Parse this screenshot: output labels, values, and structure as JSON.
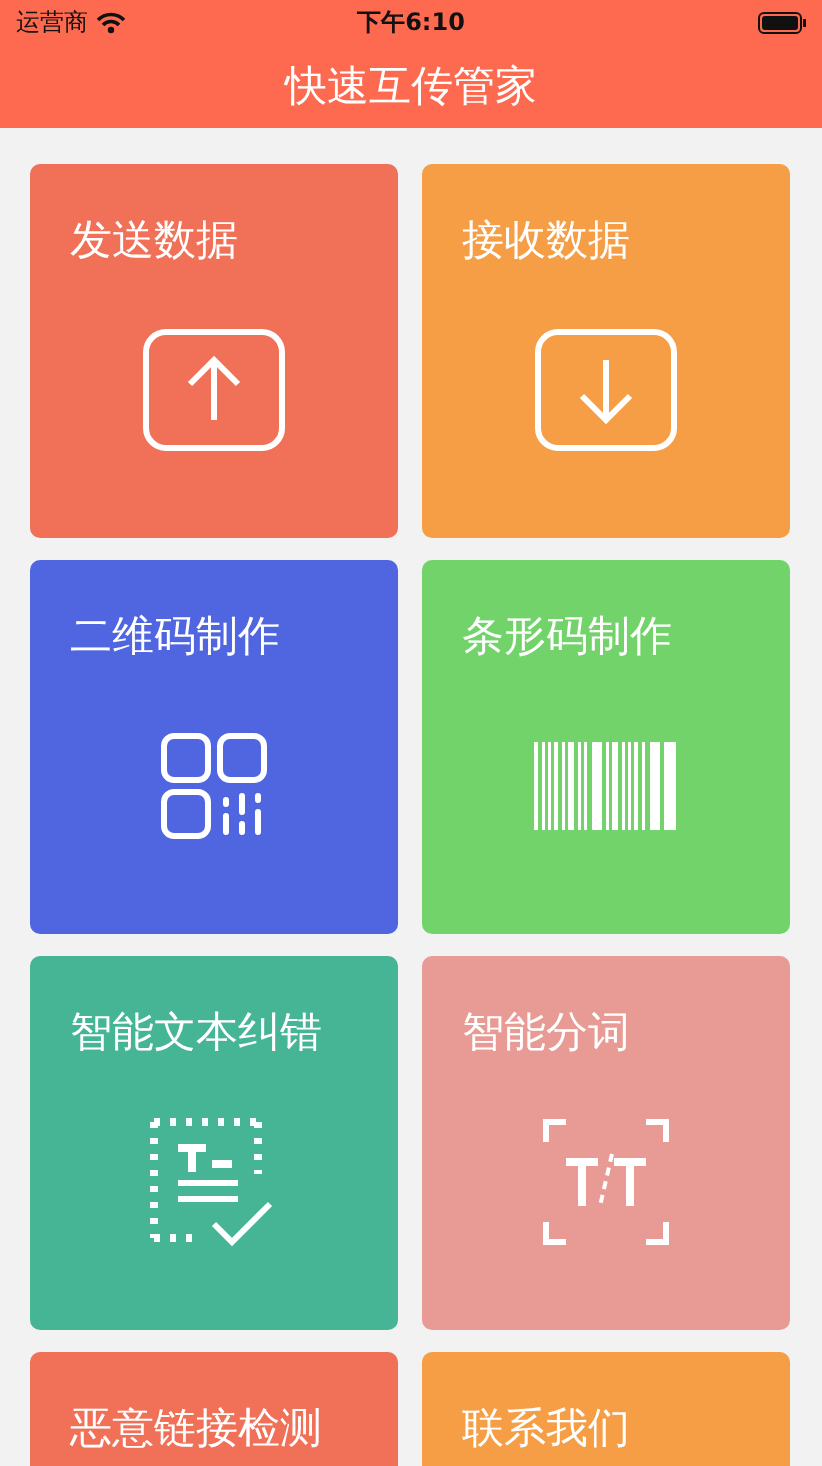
{
  "status_bar": {
    "carrier": "运营商",
    "time": "下午6:10"
  },
  "nav": {
    "title": "快速互传管家"
  },
  "cards": [
    {
      "label": "发送数据",
      "kind": "upload",
      "color": "#f07058"
    },
    {
      "label": "接收数据",
      "kind": "download",
      "color": "#f59e45"
    },
    {
      "label": "二维码制作",
      "kind": "qrcode",
      "color": "#4f66e0"
    },
    {
      "label": "条形码制作",
      "kind": "barcode",
      "color": "#72d36b"
    },
    {
      "label": "智能文本纠错",
      "kind": "textcheck",
      "color": "#46b596"
    },
    {
      "label": "智能分词",
      "kind": "split",
      "color": "#e89b94"
    },
    {
      "label": "恶意链接检测",
      "kind": "none",
      "color": "#f07058"
    },
    {
      "label": "联系我们",
      "kind": "none",
      "color": "#f59e45"
    }
  ]
}
